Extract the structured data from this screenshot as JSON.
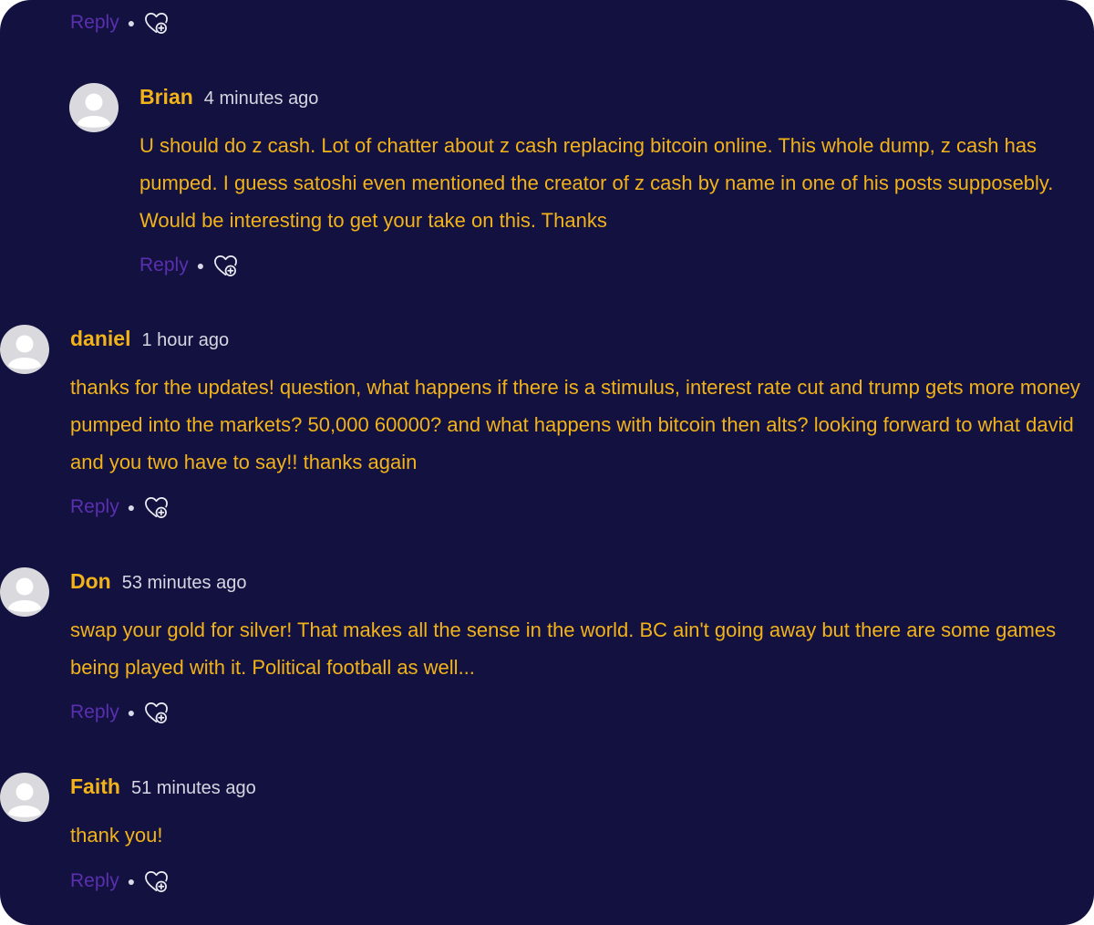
{
  "colors": {
    "background": "#12113f",
    "author": "#f2b31a",
    "body_text": "#f2b31a",
    "timestamp": "#d6d6e2",
    "reply_link": "#5a2fb0",
    "avatar_bg": "#d9d9de"
  },
  "icons": {
    "like": "heart-plus-icon",
    "avatar": "default-user-avatar-icon"
  },
  "top_actions": {
    "reply_label": "Reply"
  },
  "comments": [
    {
      "author": "Brian",
      "time": "4 minutes ago",
      "text": "U should do z cash. Lot of chatter about z cash replacing bitcoin online. This whole dump, z cash has pumped. I guess satoshi even mentioned the creator of z cash by name in one of his posts supposebly. Would be interesting to get your take on this. Thanks",
      "reply_label": "Reply"
    },
    {
      "author": "daniel",
      "time": "1 hour ago",
      "text": "thanks for the updates! question, what happens if there is a stimulus, interest rate cut and trump gets more money pumped into the markets? 50,000 60000? and what happens with bitcoin then alts? looking forward to what david and you two have to say!! thanks again",
      "reply_label": "Reply"
    },
    {
      "author": "Don",
      "time": "53 minutes ago",
      "text": "swap your gold for silver! That makes all the sense in the world. BC ain't going away but there are some games being played with it. Political football as well...",
      "reply_label": "Reply"
    },
    {
      "author": "Faith",
      "time": "51 minutes ago",
      "text": "thank you!",
      "reply_label": "Reply"
    }
  ]
}
